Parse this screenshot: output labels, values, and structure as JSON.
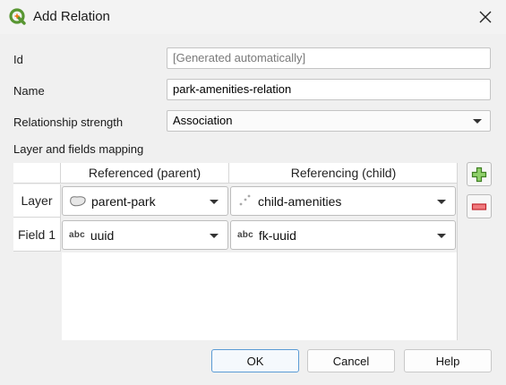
{
  "window": {
    "title": "Add Relation"
  },
  "form": {
    "id_label": "Id",
    "id_placeholder": "[Generated automatically]",
    "name_label": "Name",
    "name_value": "park-amenities-relation",
    "strength_label": "Relationship strength",
    "strength_value": "Association",
    "mapping_label": "Layer and fields mapping"
  },
  "table": {
    "columns": [
      "Referenced (parent)",
      "Referencing (child)"
    ],
    "rows": [
      {
        "header": "Layer",
        "parent": "parent-park",
        "child": "child-amenities",
        "parent_icon": "polygon-layer-icon",
        "child_icon": "point-layer-icon"
      },
      {
        "header": "Field 1",
        "parent": "uuid",
        "child": "fk-uuid",
        "parent_icon": "abc",
        "child_icon": "abc"
      }
    ]
  },
  "buttons": {
    "ok": "OK",
    "cancel": "Cancel",
    "help": "Help"
  },
  "colors": {
    "qgis_green": "#589632",
    "qgis_yellow": "#ee7913",
    "add_green": "#4c9a2a",
    "remove_red": "#d9363e",
    "default_border": "#5b9bd5"
  }
}
